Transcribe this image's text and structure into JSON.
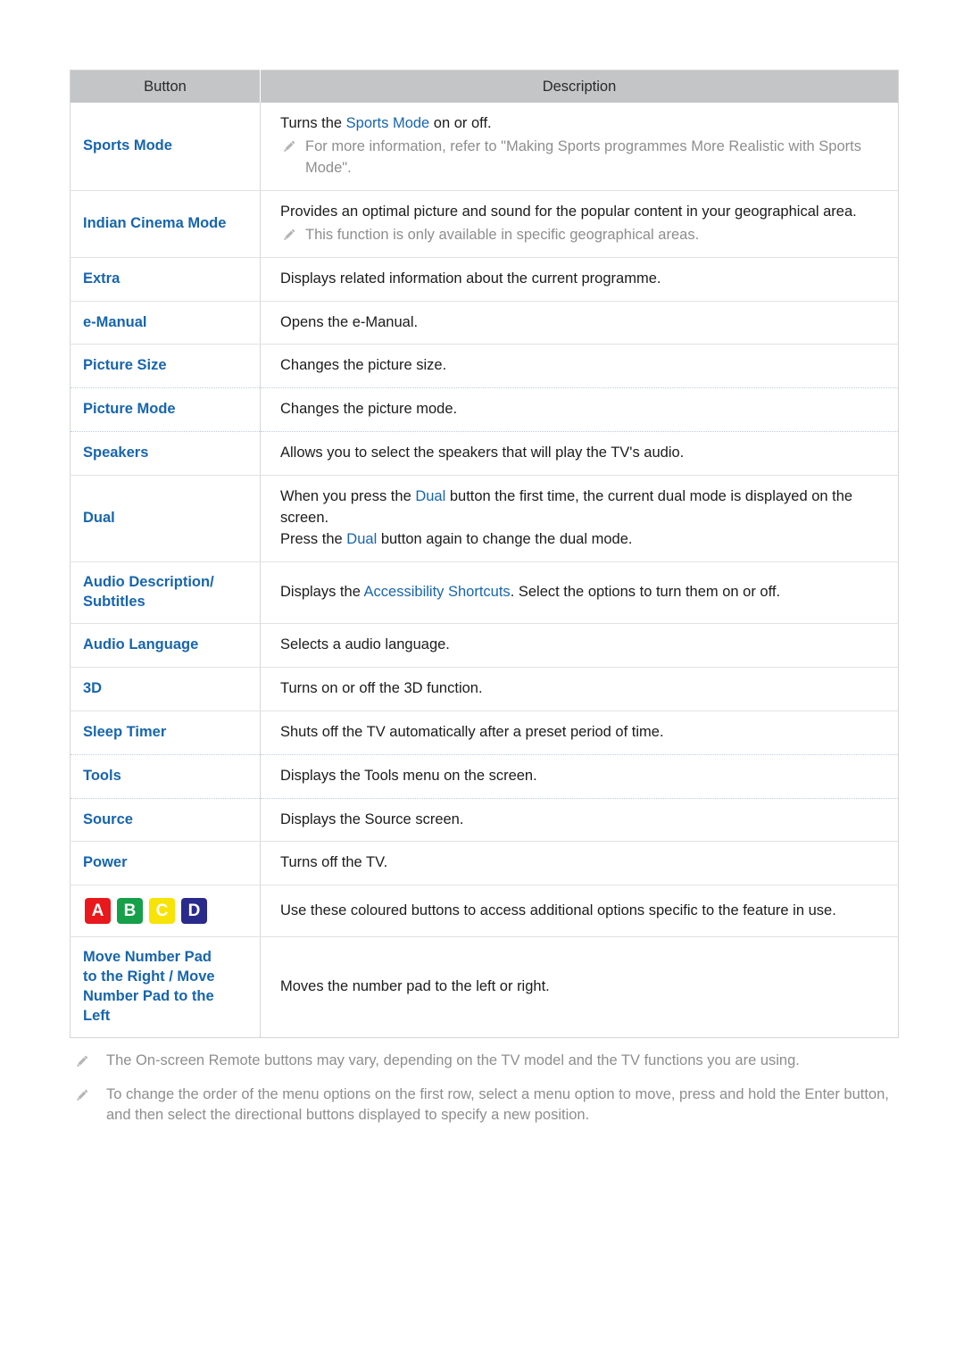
{
  "table": {
    "headers": {
      "button": "Button",
      "description": "Description"
    },
    "rows": [
      {
        "button": "Sports Mode",
        "desc_pre": "Turns the ",
        "desc_link": "Sports Mode",
        "desc_post": " on or off.",
        "note": "For more information, refer to \"Making Sports programmes More Realistic with Sports Mode\"."
      },
      {
        "button": "Indian Cinema Mode",
        "desc": "Provides an optimal picture and sound for the popular content in your geographical area.",
        "note": "This function is only available in specific geographical areas."
      },
      {
        "button": "Extra",
        "desc": "Displays related information about the current programme."
      },
      {
        "button": "e-Manual",
        "desc": "Opens the e-Manual."
      },
      {
        "button": "Picture Size",
        "desc": "Changes the picture size."
      },
      {
        "button": "Picture Mode",
        "desc": "Changes the picture mode."
      },
      {
        "button": "Speakers",
        "desc": "Allows you to select the speakers that will play the TV's audio."
      },
      {
        "button": "Dual",
        "line1_pre": "When you press the ",
        "line1_link": "Dual",
        "line1_post": " button the first time, the current dual mode is displayed on the screen.",
        "line2_pre": "Press the ",
        "line2_link": "Dual",
        "line2_post": " button again to change the dual mode."
      },
      {
        "button_line1": "Audio Description/",
        "button_line2": "Subtitles",
        "desc_pre": "Displays the ",
        "desc_link": "Accessibility Shortcuts",
        "desc_post": ". Select the options to turn them on or off."
      },
      {
        "button": "Audio Language",
        "desc": "Selects a audio language."
      },
      {
        "button": "3D",
        "desc": "Turns on or off the 3D function."
      },
      {
        "button": "Sleep Timer",
        "desc": "Shuts off the TV automatically after a preset period of time."
      },
      {
        "button": "Tools",
        "desc": "Displays the Tools menu on the screen."
      },
      {
        "button": "Source",
        "desc": "Displays the Source screen."
      },
      {
        "button": "Power",
        "desc": "Turns off the TV."
      },
      {
        "color_keys": [
          {
            "label": "A",
            "color": "#e8181c"
          },
          {
            "label": "B",
            "color": "#15a049"
          },
          {
            "label": "C",
            "color": "#f7e305"
          },
          {
            "label": "D",
            "color": "#2a2a8c"
          }
        ],
        "desc": "Use these coloured buttons to access additional options specific to the feature in use."
      },
      {
        "button_line1": "Move Number Pad",
        "button_line2": "to the Right / Move",
        "button_line3": "Number Pad to the",
        "button_line4": "Left",
        "desc": "Moves the number pad to the left or right."
      }
    ]
  },
  "footnotes": [
    "The On-screen Remote buttons may vary, depending on the TV model and the TV functions you are using.",
    "To change the order of the menu options on the first row, select a menu option to move, press and hold the Enter button, and then select the directional buttons displayed to specify a new position."
  ],
  "colors": {
    "link": "#1765ad",
    "header_bg": "#c3c5c7",
    "note_text": "#8e8e8e",
    "border": "#d6d6d6",
    "dotted_border": "#b9cfe4"
  }
}
